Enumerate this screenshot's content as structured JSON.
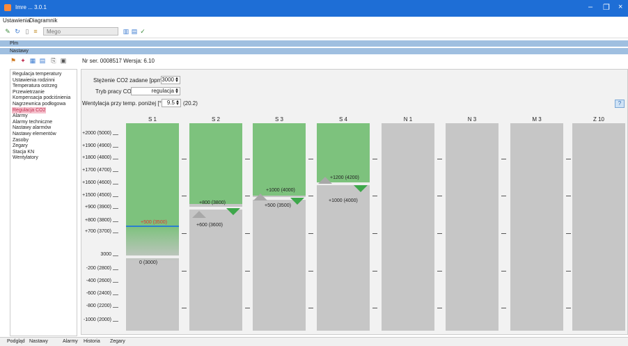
{
  "window": {
    "title": "Imre ... 3.0.1",
    "controls": [
      "–",
      "❐",
      "×"
    ]
  },
  "menu": [
    "Ustawienia",
    "Diagramnik"
  ],
  "toolbar": {
    "combo_value": "Mego"
  },
  "bands": {
    "top": "Plm",
    "second": "Nastawy"
  },
  "header": {
    "serial_text": "Nr ser. 0008517   Wersja: 6.10"
  },
  "sidebar": {
    "items": [
      "Regulacja temperatury",
      "Ustawienia rodzinni",
      "Temperatura ostrzeg",
      "Przewietrzanie",
      "Kompensacja podciśnienia",
      "Nagrzewnica podłogowa",
      "Regulacja CO2",
      "Alarmy",
      "Alarmy techniczne",
      "Nastawy alarmów",
      "Nastawy elementów",
      "Zasoby",
      "Zegary",
      "Stacja KN",
      "Wentylatory"
    ],
    "selected_index": 6
  },
  "form": {
    "co2_label": "Stężenie CO2 zadane [ppm]:",
    "co2_value": "3000",
    "mode_label": "Tryb pracy CO2:",
    "mode_value": "regulacja",
    "vent_label": "Wentylacja przy temp. poniżej [°C]:",
    "vent_value": "9.5",
    "vent_extra": "(20.2)"
  },
  "columns": [
    "S 1",
    "S 2",
    "S 3",
    "S 4",
    "N 1",
    "N 3",
    "M 3",
    "Z 10"
  ],
  "axis_ticks": [
    "+2000 (5000)",
    "+1900 (4900)",
    "+1800 (4800)",
    "+1700 (4700)",
    "+1600 (4600)",
    "+1500 (4500)",
    "+900 (3900)",
    "+800 (3800)",
    "+700 (3700)",
    "3000",
    "-200 (2800)",
    "-400 (2600)",
    "-600 (2400)",
    "-800 (2200)",
    "-1000 (2000)"
  ],
  "stages": [
    {
      "column": "S 1",
      "level_label": "+500 (3500)",
      "zero_label": "0 (3000)"
    },
    {
      "column": "S 2",
      "upper_label": "+800 (3800)",
      "lower_label": "+600 (3600)"
    },
    {
      "column": "S 3",
      "upper_label": "+1000 (4000)",
      "lower_label": "+500 (3500)"
    },
    {
      "column": "S 4",
      "upper_label": "+1200 (4200)",
      "lower_label": "+1000 (4000)"
    }
  ],
  "statusbar": [
    "Podgląd",
    "Nastawy",
    "Alarmy",
    "Historia",
    "Zegary"
  ]
}
